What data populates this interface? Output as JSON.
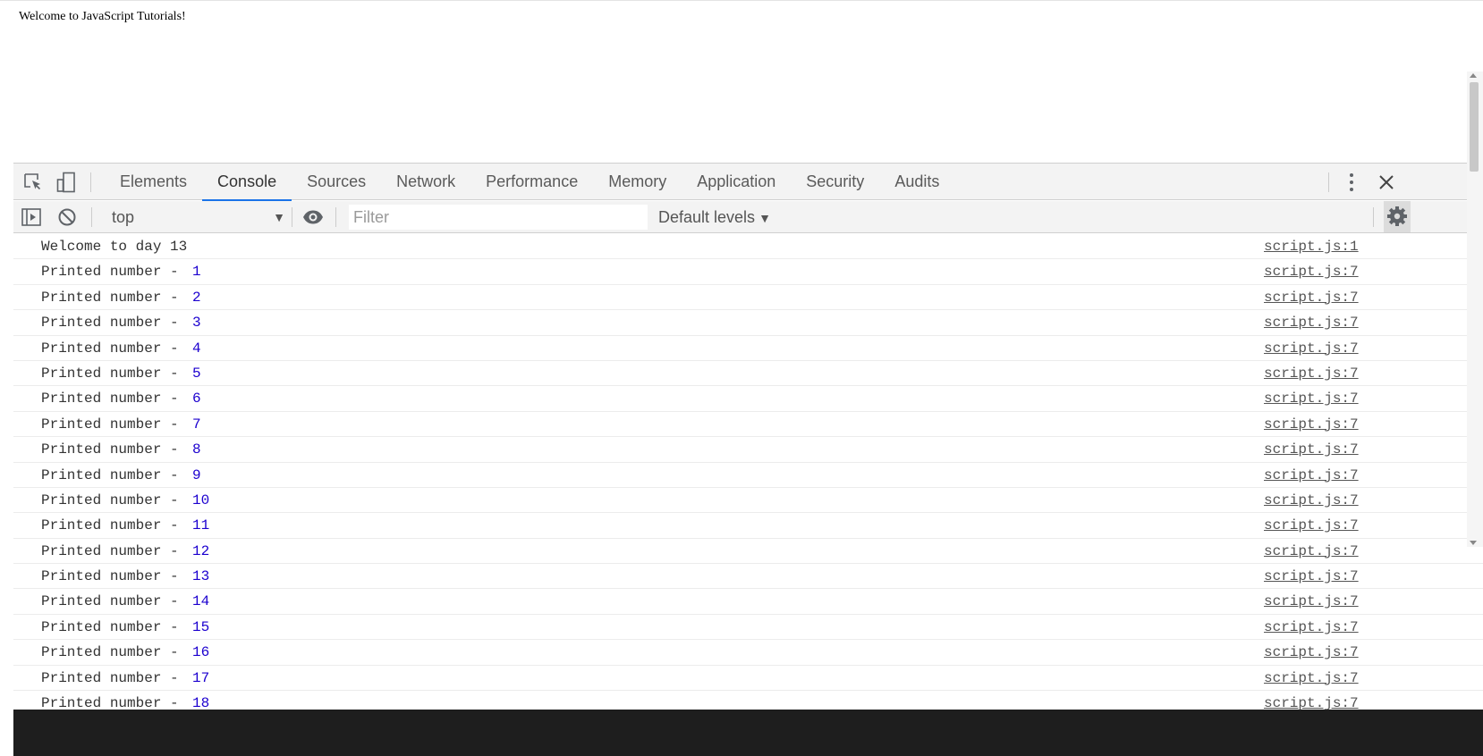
{
  "page": {
    "body_text": "Welcome to JavaScript Tutorials!"
  },
  "devtools": {
    "tabs": [
      {
        "label": "Elements",
        "active": false
      },
      {
        "label": "Console",
        "active": true
      },
      {
        "label": "Sources",
        "active": false
      },
      {
        "label": "Network",
        "active": false
      },
      {
        "label": "Performance",
        "active": false
      },
      {
        "label": "Memory",
        "active": false
      },
      {
        "label": "Application",
        "active": false
      },
      {
        "label": "Security",
        "active": false
      },
      {
        "label": "Audits",
        "active": false
      }
    ],
    "toolbar": {
      "context": "top",
      "filter_placeholder": "Filter",
      "levels": "Default levels"
    },
    "icons": {
      "inspect": "inspect-element-icon",
      "device": "device-toolbar-icon",
      "menu": "kebab-menu-icon",
      "close": "close-icon",
      "sidebar": "console-sidebar-icon",
      "clear": "clear-console-icon",
      "eye": "live-expression-eye-icon",
      "settings": "gear-icon"
    },
    "accent_color": "#1a73e8",
    "number_color": "#1c00cf"
  },
  "console": {
    "messages": [
      {
        "text": "Welcome to day 13",
        "number": "",
        "source": "script.js:1"
      },
      {
        "text": "Printed number - ",
        "number": "1",
        "source": "script.js:7"
      },
      {
        "text": "Printed number - ",
        "number": "2",
        "source": "script.js:7"
      },
      {
        "text": "Printed number - ",
        "number": "3",
        "source": "script.js:7"
      },
      {
        "text": "Printed number - ",
        "number": "4",
        "source": "script.js:7"
      },
      {
        "text": "Printed number - ",
        "number": "5",
        "source": "script.js:7"
      },
      {
        "text": "Printed number - ",
        "number": "6",
        "source": "script.js:7"
      },
      {
        "text": "Printed number - ",
        "number": "7",
        "source": "script.js:7"
      },
      {
        "text": "Printed number - ",
        "number": "8",
        "source": "script.js:7"
      },
      {
        "text": "Printed number - ",
        "number": "9",
        "source": "script.js:7"
      },
      {
        "text": "Printed number - ",
        "number": "10",
        "source": "script.js:7"
      },
      {
        "text": "Printed number - ",
        "number": "11",
        "source": "script.js:7"
      },
      {
        "text": "Printed number - ",
        "number": "12",
        "source": "script.js:7"
      },
      {
        "text": "Printed number - ",
        "number": "13",
        "source": "script.js:7"
      },
      {
        "text": "Printed number - ",
        "number": "14",
        "source": "script.js:7"
      },
      {
        "text": "Printed number - ",
        "number": "15",
        "source": "script.js:7"
      },
      {
        "text": "Printed number - ",
        "number": "16",
        "source": "script.js:7"
      },
      {
        "text": "Printed number - ",
        "number": "17",
        "source": "script.js:7"
      },
      {
        "text": "Printed number - ",
        "number": "18",
        "source": "script.js:7"
      }
    ]
  }
}
